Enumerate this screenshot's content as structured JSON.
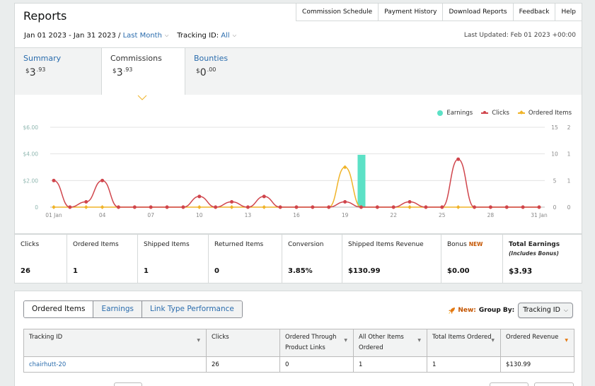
{
  "header": {
    "title": "Reports",
    "links": [
      "Commission Schedule",
      "Payment History",
      "Download Reports",
      "Feedback",
      "Help"
    ],
    "date_range": "Jan 01 2023 - Jan 31 2023 /",
    "period": "Last Month",
    "tracking_label": "Tracking ID:",
    "tracking_value": "All",
    "last_updated": "Last Updated: Feb 01 2023 +00:00"
  },
  "tabs": [
    {
      "label": "Summary",
      "currency": "$",
      "whole": "3",
      "cents": ".93"
    },
    {
      "label": "Commissions",
      "currency": "$",
      "whole": "3",
      "cents": ".93"
    },
    {
      "label": "Bounties",
      "currency": "$",
      "whole": "0",
      "cents": ".00"
    }
  ],
  "chart_data": {
    "type": "line",
    "x": [
      "01 Jan",
      "02 Jan",
      "03 Jan",
      "04 Jan",
      "05 Jan",
      "06 Jan",
      "07 Jan",
      "08 Jan",
      "09 Jan",
      "10 Jan",
      "11 Jan",
      "12 Jan",
      "13 Jan",
      "14 Jan",
      "15 Jan",
      "16 Jan",
      "17 Jan",
      "18 Jan",
      "19 Jan",
      "20 Jan",
      "21 Jan",
      "22 Jan",
      "23 Jan",
      "24 Jan",
      "25 Jan",
      "26 Jan",
      "27 Jan",
      "28 Jan",
      "29 Jan",
      "30 Jan",
      "31 Jan"
    ],
    "x_tick_labels": [
      "01 Jan",
      "04",
      "07",
      "10",
      "13",
      "16",
      "19",
      "22",
      "25",
      "28",
      "31 Jan"
    ],
    "series": [
      {
        "name": "Earnings",
        "type": "bar",
        "axis": "left",
        "color": "#5ce1c6",
        "values": [
          0,
          0,
          0,
          0,
          0,
          0,
          0,
          0,
          0,
          0,
          0,
          0,
          0,
          0,
          0,
          0,
          0,
          0,
          0,
          3.93,
          0,
          0,
          0,
          0,
          0,
          0,
          0,
          0,
          0,
          0,
          0
        ]
      },
      {
        "name": "Clicks",
        "type": "line",
        "axis": "right_clicks",
        "color": "#d0454c",
        "values": [
          5,
          0,
          1,
          5,
          0,
          0,
          0,
          0,
          0,
          2,
          0,
          1,
          0,
          2,
          0,
          0,
          0,
          0,
          1,
          0,
          0,
          0,
          1,
          0,
          0,
          9,
          0,
          0,
          0,
          0,
          0
        ]
      },
      {
        "name": "Ordered Items",
        "type": "line",
        "axis": "right_items",
        "color": "#f0b429",
        "values": [
          0,
          0,
          0,
          0,
          0,
          0,
          0,
          0,
          0,
          0,
          0,
          0,
          0,
          0,
          0,
          0,
          0,
          0,
          1,
          0,
          0,
          0,
          0,
          0,
          0,
          0,
          0,
          0,
          0,
          0,
          0
        ]
      }
    ],
    "y_left_ticks": [
      "0",
      "$2.00",
      "$4.00",
      "$6.00"
    ],
    "y_left_lim": [
      0,
      6
    ],
    "y_right_clicks_ticks": [
      "0",
      "5",
      "10",
      "15"
    ],
    "y_right_clicks_lim": [
      0,
      15
    ],
    "y_right_items_ticks": [
      "0",
      "1",
      "1",
      "2"
    ],
    "y_right_items_lim": [
      0,
      2
    ],
    "legend_position": "top-right",
    "grid": true
  },
  "metrics": [
    {
      "label": "Clicks",
      "value": "26"
    },
    {
      "label": "Ordered Items",
      "value": "1"
    },
    {
      "label": "Shipped Items",
      "value": "1"
    },
    {
      "label": "Returned Items",
      "value": "0"
    },
    {
      "label": "Conversion",
      "value": "3.85%"
    },
    {
      "label": "Shipped Items Revenue",
      "value": "$130.99"
    },
    {
      "label": "Bonus",
      "badge": "NEW",
      "value": "$0.00"
    },
    {
      "label": "Total Earnings",
      "sub": "(Includes Bonus)",
      "value": "$3.93"
    }
  ],
  "report": {
    "tabs": [
      "Ordered Items",
      "Earnings",
      "Link Type Performance"
    ],
    "group_new": "New:",
    "group_by_label": "Group By:",
    "group_by_value": "Tracking ID",
    "columns": [
      "Tracking ID",
      "Clicks",
      "Ordered Through Product Links",
      "All Other Items Ordered",
      "Total Items Ordered",
      "Ordered Revenue"
    ],
    "rows": [
      [
        "chairhutt-20",
        "26",
        "0",
        "1",
        "1",
        "$130.99"
      ]
    ]
  }
}
